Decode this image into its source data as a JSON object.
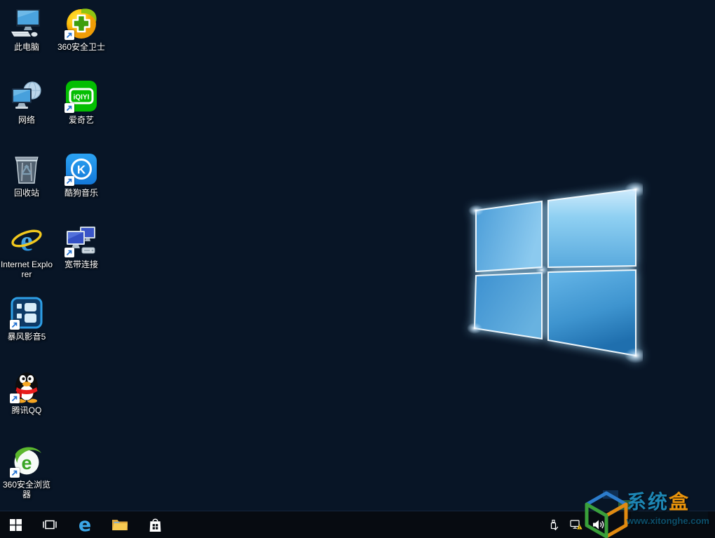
{
  "desktop": {
    "icons": [
      {
        "label": "此电脑",
        "name": "this-pc",
        "shortcut": false
      },
      {
        "label": "360安全卫士",
        "name": "360-safe-guard",
        "shortcut": true
      },
      {
        "label": "网络",
        "name": "network",
        "shortcut": false
      },
      {
        "label": "爱奇艺",
        "name": "iqiyi",
        "shortcut": true
      },
      {
        "label": "回收站",
        "name": "recycle-bin",
        "shortcut": false
      },
      {
        "label": "酷狗音乐",
        "name": "kugou-music",
        "shortcut": true
      },
      {
        "label": "Internet Explorer",
        "name": "internet-explorer",
        "shortcut": false
      },
      {
        "label": "宽带连接",
        "name": "broadband-connection",
        "shortcut": true
      },
      {
        "label": "暴风影音5",
        "name": "baofeng-player-5",
        "shortcut": true
      },
      {
        "label": "腾讯QQ",
        "name": "tencent-qq",
        "shortcut": true
      },
      {
        "label": "360安全浏览器",
        "name": "360-secure-browser",
        "shortcut": true
      }
    ],
    "glyphs": {
      "iqiyi": "iQIYI",
      "kugou": "K",
      "ie": "e",
      "browser360": "e"
    }
  },
  "taskbar": {
    "edge_letter": "e",
    "buttons": [
      "start",
      "task-view",
      "microsoft-edge",
      "file-explorer",
      "windows-store"
    ],
    "tray": [
      "usb-safely-remove",
      "network-status-warning",
      "volume"
    ]
  },
  "watermark": {
    "title_blue": "系统",
    "title_orange": "盒",
    "url": "www.xitonghe.com"
  },
  "colors": {
    "wallpaper_accent": "#2b6fb4",
    "taskbar_bg": "#070b11",
    "iqiyi_green": "#04be02",
    "kugou_blue": "#1f8fe8",
    "qq_red": "#e81c1c",
    "safe360_yellow": "#ffc810",
    "watermark_blue": "#1d86b4",
    "watermark_orange": "#e8930c"
  }
}
